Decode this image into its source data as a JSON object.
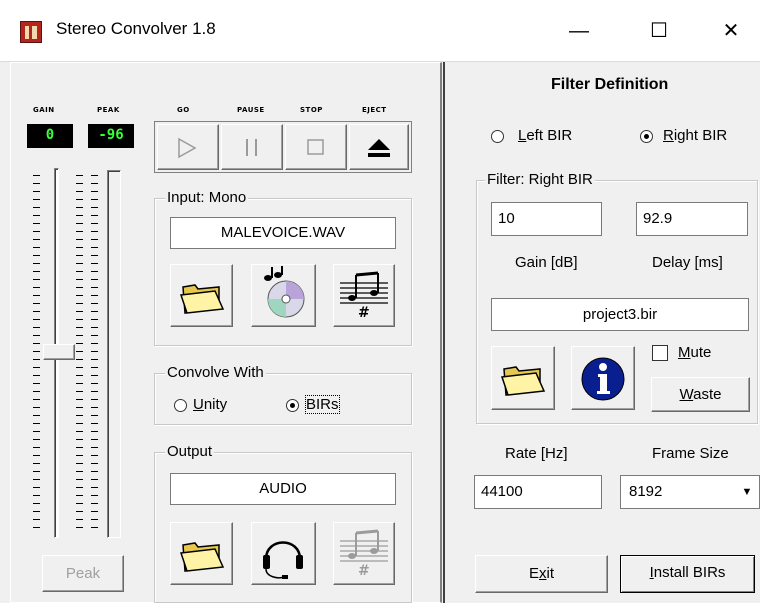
{
  "window": {
    "title": "Stereo Convolver 1.8",
    "minimize_glyph": "—",
    "maximize_glyph": "☐",
    "close_glyph": "✕"
  },
  "meters": {
    "gain_label": "GAIN",
    "peak_label": "PEAK",
    "gain_value": "0",
    "peak_value": "-96",
    "peak_button": "Peak"
  },
  "transport": {
    "go_label": "GO",
    "pause_label": "PAUSE",
    "stop_label": "STOP",
    "eject_label": "EJECT"
  },
  "input": {
    "legend": "Input: Mono",
    "filename": "MALEVOICE.WAV"
  },
  "convolve": {
    "legend": "Convolve With",
    "unity_prefix": "U",
    "unity_rest": "nity",
    "birs_label": "BIRs",
    "selected": "BIRs"
  },
  "output": {
    "legend": "Output",
    "target": "AUDIO"
  },
  "filter": {
    "heading": "Filter Definition",
    "left_bir_prefix": "L",
    "left_bir_rest": "eft BIR",
    "right_bir_prefix": "R",
    "right_bir_rest": "ight BIR",
    "selected": "Right BIR",
    "group_legend": "Filter: Right BIR",
    "gain_value": "10",
    "gain_label": "Gain [dB]",
    "delay_value": "92.9",
    "delay_label": "Delay [ms]",
    "bir_file": "project3.bir",
    "mute_prefix": "M",
    "mute_rest": "ute",
    "waste_prefix": "W",
    "waste_rest": "aste"
  },
  "rate": {
    "label": "Rate [Hz]",
    "value": "44100"
  },
  "frame": {
    "label": "Frame Size",
    "value": "8192"
  },
  "buttons": {
    "exit_pre": "E",
    "exit_u": "x",
    "exit_post": "it",
    "install_u": "I",
    "install_post": "nstall BIRs"
  },
  "icons": {
    "folder": "folder-icon",
    "cd": "cd-icon",
    "score": "music-score-icon",
    "info": "info-icon",
    "headphones": "headphones-icon"
  }
}
